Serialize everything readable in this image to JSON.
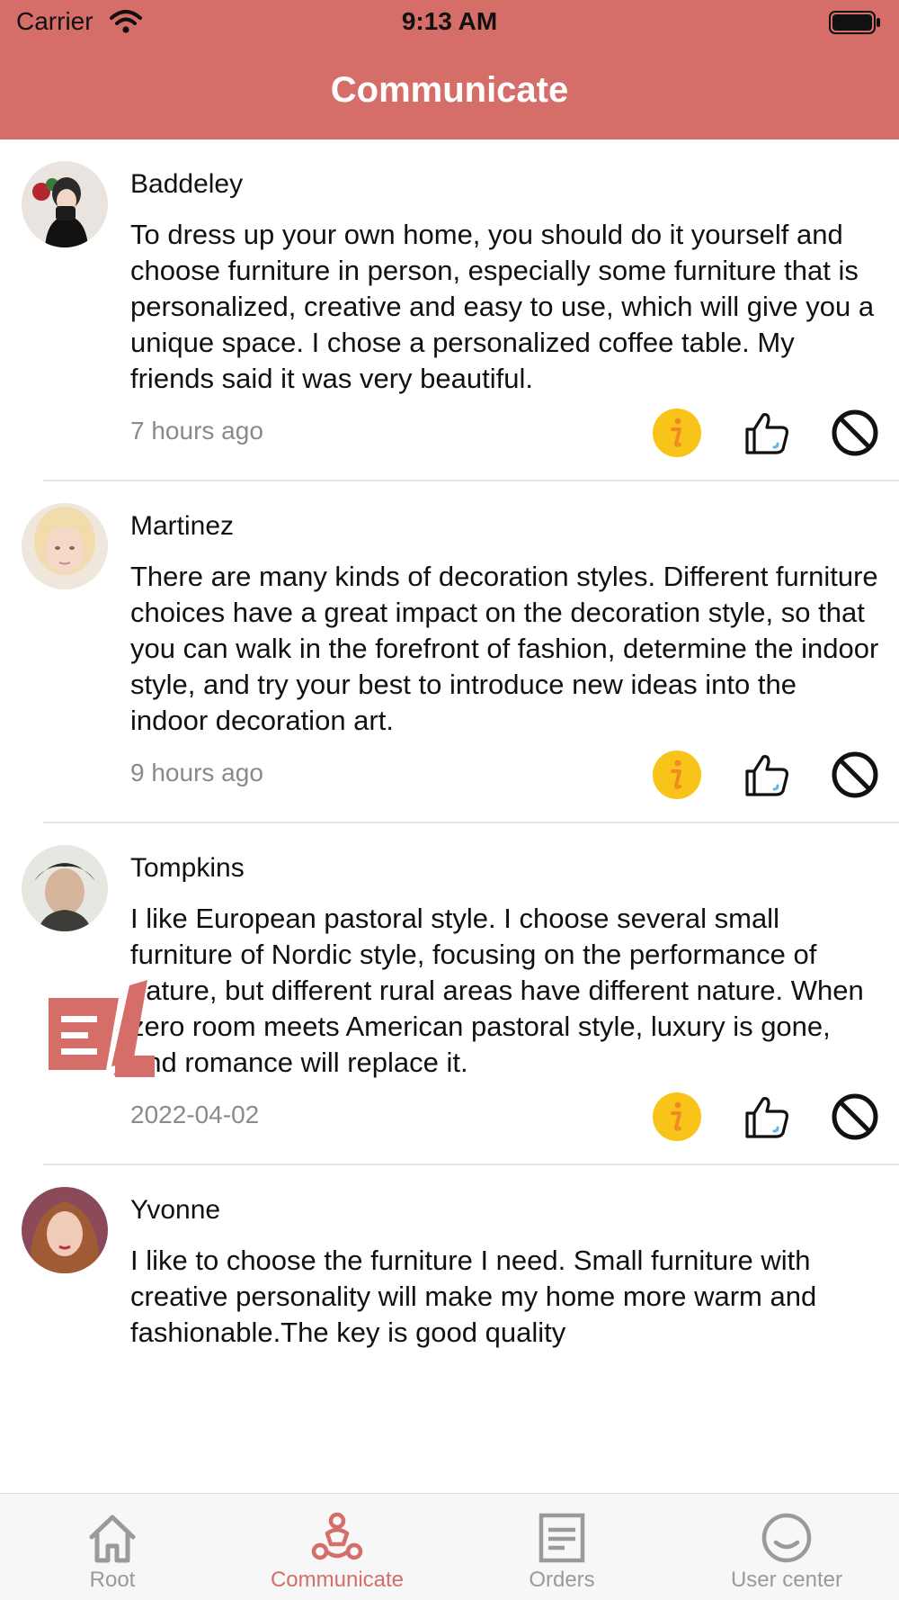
{
  "status_bar": {
    "carrier": "Carrier",
    "time": "9:13 AM"
  },
  "header": {
    "title": "Communicate"
  },
  "posts": [
    {
      "username": "Baddeley",
      "content": "To dress up your own home, you should do it yourself and choose furniture in person, especially some furniture that is personalized, creative and easy to use, which will give you a unique space. I chose a personalized coffee table. My friends said it was very beautiful.",
      "timestamp": "7 hours ago"
    },
    {
      "username": "Martinez",
      "content": "There are many kinds of decoration styles. Different furniture choices have a great impact on the decoration style, so that you can walk in the forefront of fashion, determine the indoor style, and try your best to introduce new ideas into the indoor decoration art.",
      "timestamp": "9 hours ago"
    },
    {
      "username": "Tompkins",
      "content": "I like European pastoral style. I choose several small furniture of Nordic style, focusing on the performance of nature, but different rural areas have different nature. When zero room meets American pastoral style, luxury is gone, and romance will replace it.",
      "timestamp": "2022-04-02"
    },
    {
      "username": "Yvonne",
      "content": "I like to choose the furniture I need. Small furniture with creative personality will make my home more warm and fashionable.The key is good quality",
      "timestamp": ""
    }
  ],
  "tabbar": {
    "items": [
      {
        "label": "Root",
        "icon": "home-icon"
      },
      {
        "label": "Communicate",
        "icon": "community-icon"
      },
      {
        "label": "Orders",
        "icon": "orders-icon"
      },
      {
        "label": "User center",
        "icon": "user-center-icon"
      }
    ],
    "active": "Communicate"
  },
  "colors": {
    "accent": "#D56D69",
    "info_badge": "#F9C41A",
    "info_glyph": "#F28A22",
    "timestamp": "#8A8A8A",
    "tab_inactive": "#9A9A9A"
  }
}
